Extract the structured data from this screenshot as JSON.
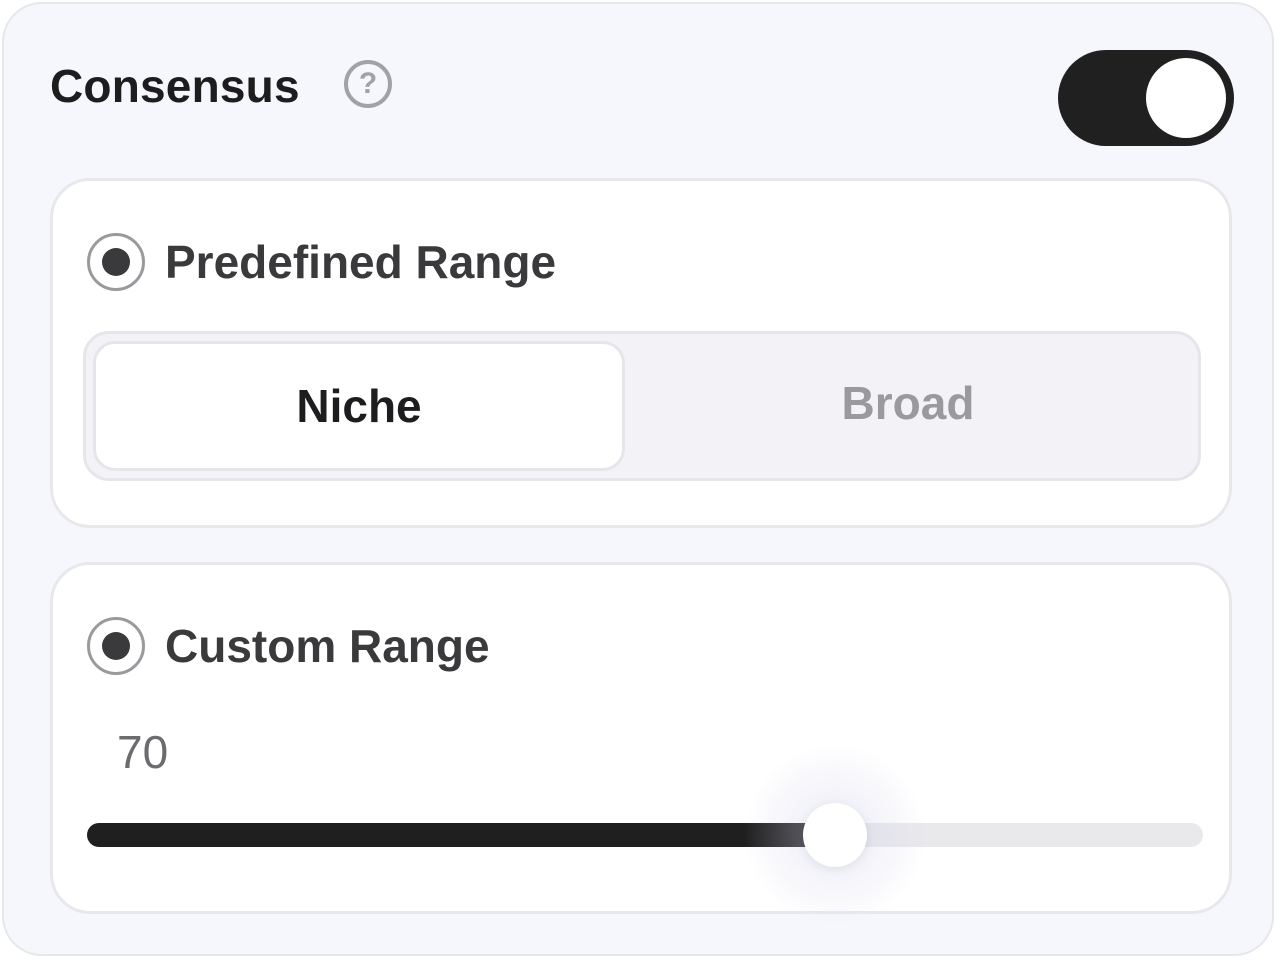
{
  "header": {
    "title": "Consensus",
    "help_icon": "question-mark-circle-icon",
    "help_glyph": "?",
    "toggle_on": true
  },
  "predefined": {
    "label": "Predefined Range",
    "selected": true,
    "options": [
      "Niche",
      "Broad"
    ],
    "active_option": "Niche"
  },
  "custom": {
    "label": "Custom Range",
    "selected": true,
    "value": "70",
    "fraction": 0.67
  },
  "colors": {
    "accent": "#1f1f1f",
    "panel_bg": "#f6f7fc",
    "muted": "#9a9a9e"
  }
}
